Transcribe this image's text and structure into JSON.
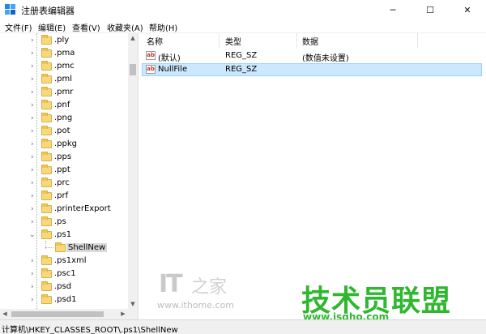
{
  "window": {
    "title": "注册表编辑器",
    "minimize_glyph": "─",
    "maximize_glyph": "☐",
    "close_glyph": "✕"
  },
  "menu": [
    {
      "label": "文件(F)"
    },
    {
      "label": "编辑(E)"
    },
    {
      "label": "查看(V)"
    },
    {
      "label": "收藏夹(A)"
    },
    {
      "label": "帮助(H)"
    }
  ],
  "tree": {
    "items": [
      {
        "label": ".ply",
        "expandable": true
      },
      {
        "label": ".pma",
        "expandable": true
      },
      {
        "label": ".pmc",
        "expandable": true
      },
      {
        "label": ".pml",
        "expandable": true
      },
      {
        "label": ".pmr",
        "expandable": true
      },
      {
        "label": ".pnf",
        "expandable": true
      },
      {
        "label": ".png",
        "expandable": true
      },
      {
        "label": ".pot",
        "expandable": true
      },
      {
        "label": ".ppkg",
        "expandable": true
      },
      {
        "label": ".pps",
        "expandable": true
      },
      {
        "label": ".ppt",
        "expandable": true
      },
      {
        "label": ".prc",
        "expandable": true
      },
      {
        "label": ".prf",
        "expandable": true
      },
      {
        "label": ".printerExport",
        "expandable": true
      },
      {
        "label": ".ps",
        "expandable": true
      },
      {
        "label": ".ps1",
        "expandable": true,
        "expanded": true
      },
      {
        "label": "ShellNew",
        "child": true,
        "selected": true
      },
      {
        "label": ".ps1xml",
        "expandable": true
      },
      {
        "label": ".psc1",
        "expandable": true
      },
      {
        "label": ".psd",
        "expandable": true
      },
      {
        "label": ".psd1",
        "expandable": true
      }
    ]
  },
  "list": {
    "columns": [
      "名称",
      "类型",
      "数据"
    ],
    "rows": [
      {
        "name": "(默认)",
        "type": "REG_SZ",
        "data": "(数值未设置)",
        "icon": "ab-icon"
      },
      {
        "name": "NullFile",
        "type": "REG_SZ",
        "data": "",
        "icon": "ab-icon",
        "selected": true
      }
    ]
  },
  "status": {
    "path": "计算机\\HKEY_CLASSES_ROOT\\.ps1\\ShellNew"
  },
  "watermarks": {
    "it_logo": "IT",
    "it_logo_cn": "之家",
    "ithome_url": "www.ithome.com",
    "brand": "技术员联盟",
    "brand_url": "www.jsgho.com"
  }
}
